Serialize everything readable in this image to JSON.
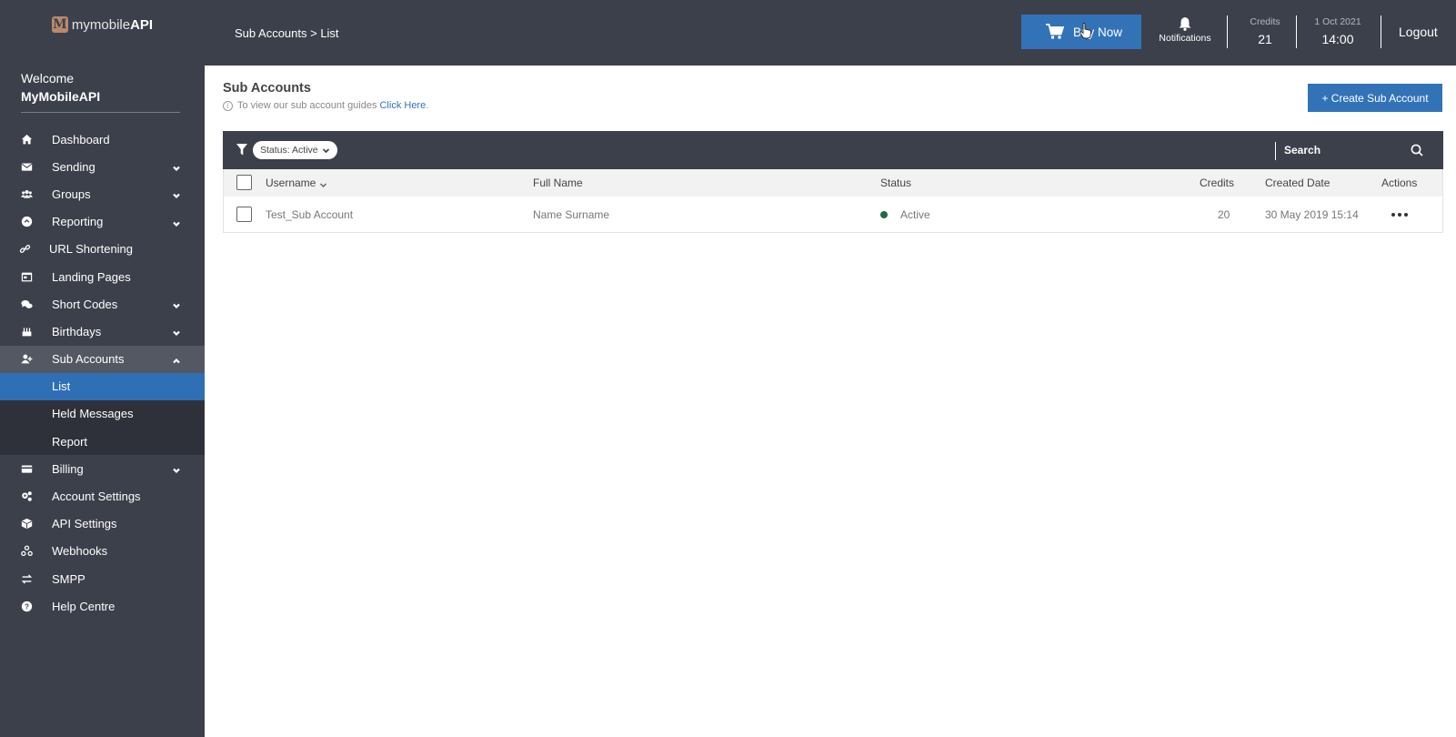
{
  "sidebar": {
    "logo": {
      "prefix": "mymobile",
      "bold": "API",
      "mark": "M"
    },
    "welcome": "Welcome",
    "user": "MyMobileAPI",
    "items": [
      {
        "label": "Dashboard",
        "icon": "home-icon",
        "chevron": ""
      },
      {
        "label": "Sending",
        "icon": "envelope-icon",
        "chevron": "down"
      },
      {
        "label": "Groups",
        "icon": "users-icon",
        "chevron": "down"
      },
      {
        "label": "Reporting",
        "icon": "reporting-icon",
        "chevron": "down"
      },
      {
        "label": "URL Shortening",
        "icon": "link-icon",
        "chevron": ""
      },
      {
        "label": "Landing Pages",
        "icon": "browser-icon",
        "chevron": ""
      },
      {
        "label": "Short Codes",
        "icon": "chat-icon",
        "chevron": "down"
      },
      {
        "label": "Birthdays",
        "icon": "cake-icon",
        "chevron": "down"
      },
      {
        "label": "Sub Accounts",
        "icon": "user-plus-icon",
        "chevron": "up"
      },
      {
        "label": "List",
        "sub": true,
        "active": true
      },
      {
        "label": "Held Messages",
        "sub": true
      },
      {
        "label": "Report",
        "sub": true
      },
      {
        "label": "Billing",
        "icon": "credit-card-icon",
        "chevron": "down"
      },
      {
        "label": "Account Settings",
        "icon": "cogs-icon",
        "chevron": ""
      },
      {
        "label": "API Settings",
        "icon": "cube-icon",
        "chevron": ""
      },
      {
        "label": "Webhooks",
        "icon": "webhook-icon",
        "chevron": ""
      },
      {
        "label": "SMPP",
        "icon": "exchange-icon",
        "chevron": ""
      },
      {
        "label": "Help Centre",
        "icon": "question-icon",
        "chevron": ""
      }
    ]
  },
  "header": {
    "breadcrumb": "Sub Accounts > List",
    "buy_label": "Buy Now",
    "notifications_label": "Notifications",
    "credits_label": "Credits",
    "credits_value": "21",
    "date_label": "1 Oct 2021",
    "time_value": "14:00",
    "logout_label": "Logout"
  },
  "page": {
    "title": "Sub Accounts",
    "info_text": "To view our sub account guides",
    "info_link": "Click Here",
    "info_end": ".",
    "create_label": "+ Create Sub Account"
  },
  "filter": {
    "chip_label": "Status: Active",
    "search_placeholder": "Search"
  },
  "table": {
    "headers": {
      "username": "Username",
      "full_name": "Full Name",
      "status": "Status",
      "credits": "Credits",
      "created": "Created Date",
      "actions": "Actions"
    },
    "rows": [
      {
        "username": "Test_Sub Account",
        "full_name": "Name Surname",
        "status": "Active",
        "status_color": "#1f6b4a",
        "credits": "20",
        "created": "30 May 2019 15:14"
      }
    ]
  },
  "colors": {
    "sidebar_bg": "#3c404b",
    "accent": "#3273b8"
  }
}
